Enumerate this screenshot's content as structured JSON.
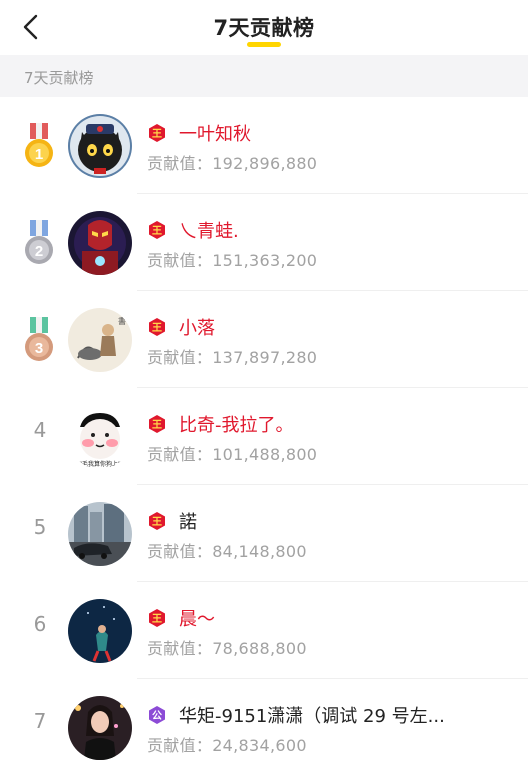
{
  "header": {
    "title": "7天贡献榜"
  },
  "section": {
    "label": "7天贡献榜"
  },
  "colors": {
    "accent_yellow": "#ffd500",
    "name_red": "#e0182d",
    "muted_gray": "#a2a2a2",
    "badge_red": "#e0182d",
    "badge_purple": "#8c4bd6"
  },
  "contrib_prefix": "贡献值：",
  "rankings": [
    {
      "rank": "1",
      "medal": "gold-medal-icon",
      "badge": "crown-badge-icon",
      "name": "一叶知秋",
      "value": "192,896,880"
    },
    {
      "rank": "2",
      "medal": "silver-medal-icon",
      "badge": "crown-badge-icon",
      "name": "乀青蛙.",
      "value": "151,363,200"
    },
    {
      "rank": "3",
      "medal": "bronze-medal-icon",
      "badge": "crown-badge-icon",
      "name": "小落",
      "value": "137,897,280"
    },
    {
      "rank": "4",
      "badge": "crown-badge-icon",
      "name": "比奇-我拉了。",
      "value": "101,488,800"
    },
    {
      "rank": "5",
      "badge": "crown-badge-icon",
      "name": "諾",
      "value": "84,148,800"
    },
    {
      "rank": "6",
      "badge": "crown-badge-icon",
      "name": "晨～",
      "value": "78,688,800"
    },
    {
      "rank": "7",
      "badge": "purple-badge-icon",
      "name": "华矩-9151潇潇（调试 29 号左...",
      "value": "24,834,600"
    }
  ]
}
